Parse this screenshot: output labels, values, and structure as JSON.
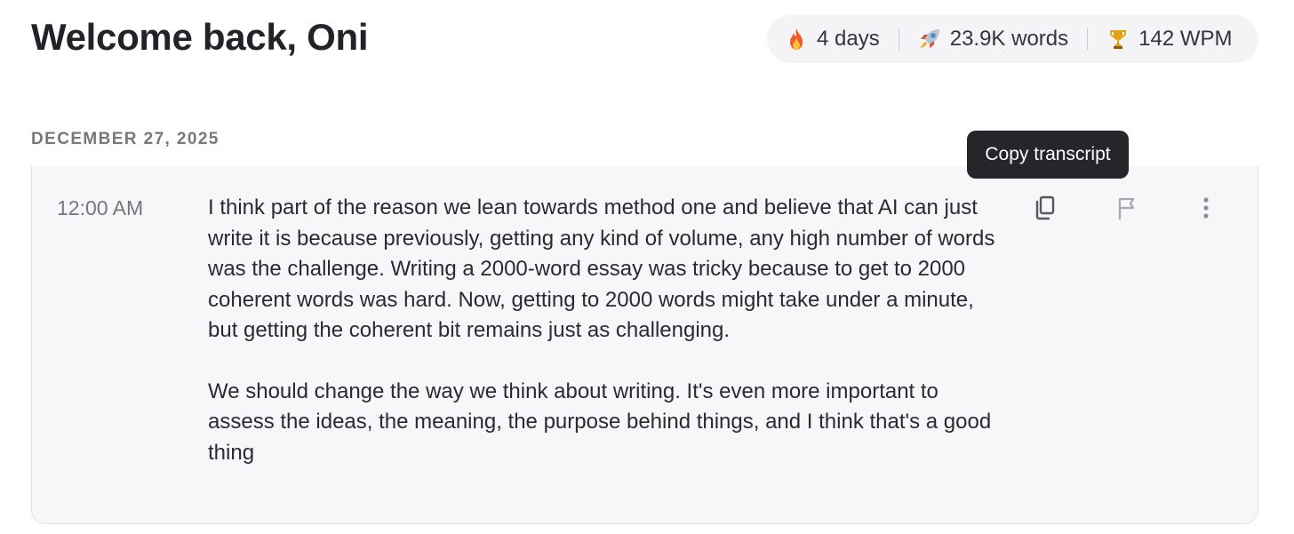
{
  "header": {
    "title": "Welcome back, Oni"
  },
  "stats": [
    {
      "icon": "fire-icon",
      "value": "4 days"
    },
    {
      "icon": "rocket-icon",
      "value": "23.9K words"
    },
    {
      "icon": "trophy-icon",
      "value": "142 WPM"
    }
  ],
  "date_heading": "DECEMBER 27, 2025",
  "entry": {
    "time": "12:00 AM",
    "paragraphs": [
      "I think part of the reason we lean towards method one and believe that AI can just write it is because previously, getting any kind of volume, any high number of words was the challenge. Writing a 2000-word essay was tricky because to get to 2000 coherent words was hard. Now, getting to 2000 words might take under a minute, but getting the coherent bit remains just as challenging.",
      "We should change the way we think about writing. It's even more important to assess the ideas, the meaning, the purpose behind things, and I think that's a good thing"
    ],
    "actions": [
      {
        "icon": "copy-icon"
      },
      {
        "icon": "flag-icon"
      },
      {
        "icon": "more-vertical-icon"
      }
    ]
  },
  "tooltip": {
    "text": "Copy transcript"
  },
  "colors": {
    "card_bg": "#f7f7f9",
    "tooltip_bg": "#25252a",
    "pill_bg": "#f4f4f6"
  }
}
